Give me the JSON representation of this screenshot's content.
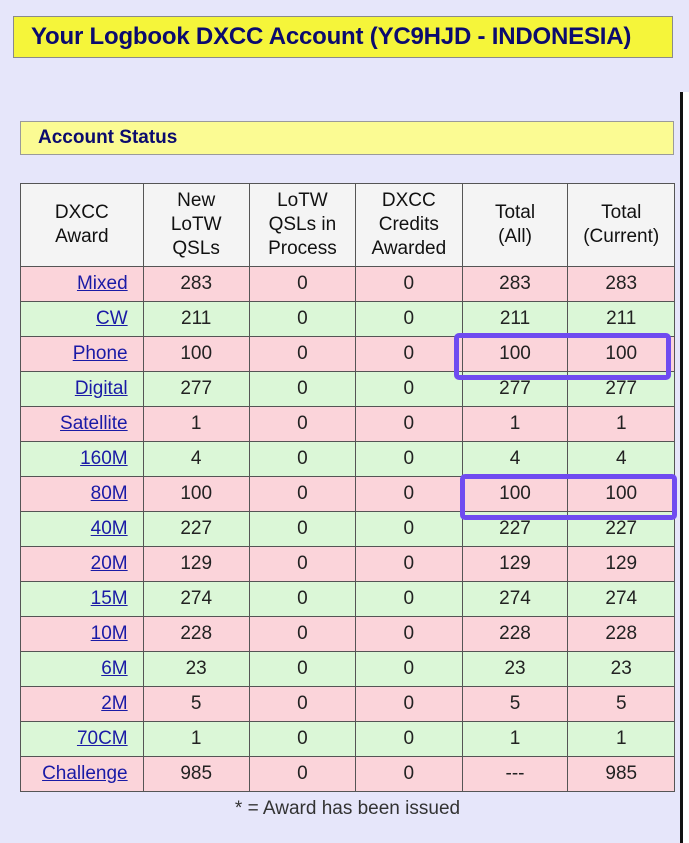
{
  "header": {
    "title": "Your Logbook DXCC Account (YC9HJD - INDONESIA)"
  },
  "section": {
    "title": "Account Status"
  },
  "table": {
    "columns": [
      [
        "DXCC",
        "Award"
      ],
      [
        "New",
        "LoTW",
        "QSLs"
      ],
      [
        "LoTW",
        "QSLs in",
        "Process"
      ],
      [
        "DXCC",
        "Credits",
        "Awarded"
      ],
      [
        "Total",
        "(All)"
      ],
      [
        "Total",
        "(Current)"
      ]
    ],
    "rows": [
      {
        "award": "Mixed",
        "new": "283",
        "process": "0",
        "awarded": "0",
        "total_all": "283",
        "total_current": "283",
        "row_color": "pink"
      },
      {
        "award": "CW",
        "new": "211",
        "process": "0",
        "awarded": "0",
        "total_all": "211",
        "total_current": "211",
        "row_color": "green"
      },
      {
        "award": "Phone",
        "new": "100",
        "process": "0",
        "awarded": "0",
        "total_all": "100",
        "total_current": "100",
        "row_color": "pink"
      },
      {
        "award": "Digital",
        "new": "277",
        "process": "0",
        "awarded": "0",
        "total_all": "277",
        "total_current": "277",
        "row_color": "green"
      },
      {
        "award": "Satellite",
        "new": "1",
        "process": "0",
        "awarded": "0",
        "total_all": "1",
        "total_current": "1",
        "row_color": "pink"
      },
      {
        "award": "160M",
        "new": "4",
        "process": "0",
        "awarded": "0",
        "total_all": "4",
        "total_current": "4",
        "row_color": "green"
      },
      {
        "award": "80M",
        "new": "100",
        "process": "0",
        "awarded": "0",
        "total_all": "100",
        "total_current": "100",
        "row_color": "pink"
      },
      {
        "award": "40M",
        "new": "227",
        "process": "0",
        "awarded": "0",
        "total_all": "227",
        "total_current": "227",
        "row_color": "green"
      },
      {
        "award": "20M",
        "new": "129",
        "process": "0",
        "awarded": "0",
        "total_all": "129",
        "total_current": "129",
        "row_color": "pink"
      },
      {
        "award": "15M",
        "new": "274",
        "process": "0",
        "awarded": "0",
        "total_all": "274",
        "total_current": "274",
        "row_color": "green"
      },
      {
        "award": "10M",
        "new": "228",
        "process": "0",
        "awarded": "0",
        "total_all": "228",
        "total_current": "228",
        "row_color": "pink"
      },
      {
        "award": "6M",
        "new": "23",
        "process": "0",
        "awarded": "0",
        "total_all": "23",
        "total_current": "23",
        "row_color": "green"
      },
      {
        "award": "2M",
        "new": "5",
        "process": "0",
        "awarded": "0",
        "total_all": "5",
        "total_current": "5",
        "row_color": "pink"
      },
      {
        "award": "70CM",
        "new": "1",
        "process": "0",
        "awarded": "0",
        "total_all": "1",
        "total_current": "1",
        "row_color": "green"
      },
      {
        "award": "Challenge",
        "new": "985",
        "process": "0",
        "awarded": "0",
        "total_all": "---",
        "total_current": "985",
        "row_color": "pink"
      }
    ]
  },
  "footnote": "* = Award has been issued",
  "colors": {
    "header_bg": "#f5f53a",
    "section_bg": "#fbfb93",
    "row_pink": "#fbd4da",
    "row_green": "#dbf7d7",
    "link": "#1a1aa6",
    "highlight": "#6f4bf0"
  }
}
